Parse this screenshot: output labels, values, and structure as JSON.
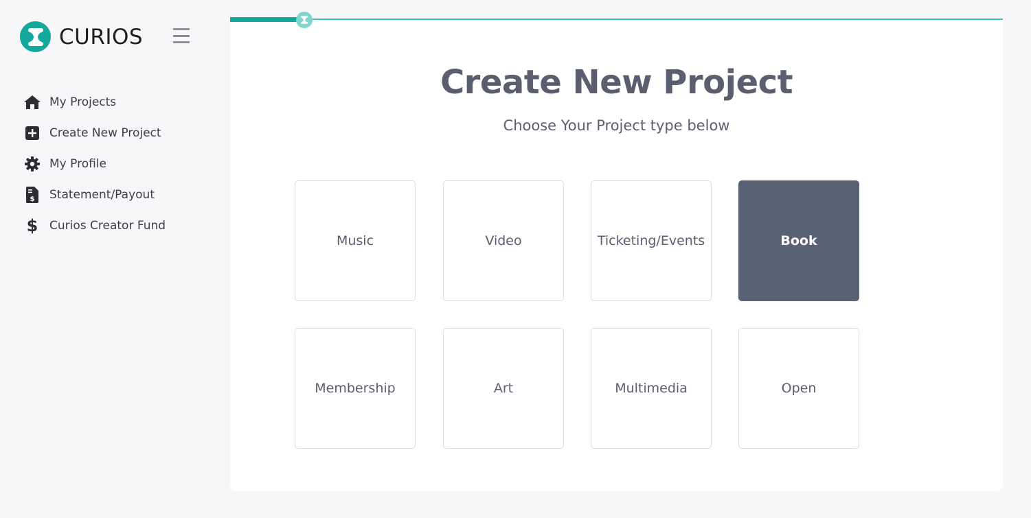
{
  "brand": {
    "name": "CURIOS",
    "accent_color": "#14a89c"
  },
  "sidebar": {
    "items": [
      {
        "label": "My Projects",
        "icon": "home-icon"
      },
      {
        "label": "Create New Project",
        "icon": "plus-square-icon"
      },
      {
        "label": "My Profile",
        "icon": "gear-icon"
      },
      {
        "label": "Statement/Payout",
        "icon": "invoice-dollar-icon"
      },
      {
        "label": "Curios Creator Fund",
        "icon": "dollar-sign-icon"
      }
    ]
  },
  "main": {
    "title": "Create New Project",
    "subtitle": "Choose Your Project type below",
    "progress_percent": 10,
    "project_types": [
      {
        "label": "Music",
        "selected": false
      },
      {
        "label": "Video",
        "selected": false
      },
      {
        "label": "Ticketing/Events",
        "selected": false
      },
      {
        "label": "Book",
        "selected": true
      },
      {
        "label": "Membership",
        "selected": false
      },
      {
        "label": "Art",
        "selected": false
      },
      {
        "label": "Multimedia",
        "selected": false
      },
      {
        "label": "Open",
        "selected": false
      }
    ],
    "selected_color": "#596274"
  }
}
